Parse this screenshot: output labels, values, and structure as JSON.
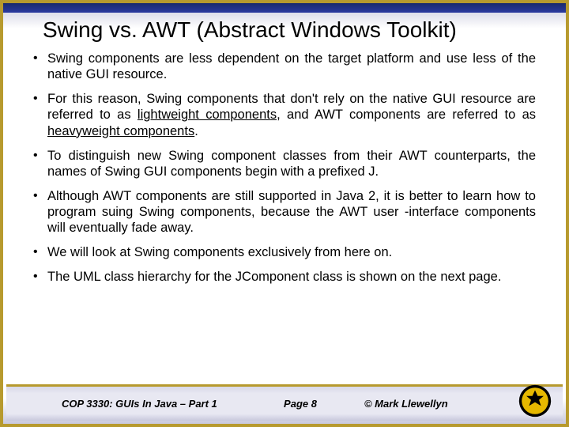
{
  "title": "Swing vs. AWT (Abstract Windows Toolkit)",
  "bullets": {
    "b0": "Swing components are less dependent on the target platform and use less of the native GUI resource.",
    "b1a": "For this reason, Swing components that don't rely on the native GUI resource are referred to as ",
    "b1u1": "lightweight components",
    "b1b": ", and AWT components are referred to as ",
    "b1u2": "heavyweight components",
    "b1c": ".",
    "b2": "To distinguish new Swing component classes from their AWT counterparts, the names of Swing GUI components begin with a prefixed J.",
    "b3": "Although AWT components are still supported in Java 2, it is better to learn how to program suing Swing components, because the AWT user -interface components will eventually fade away.",
    "b4": "We will look at Swing components exclusively from here on.",
    "b5": "The UML class hierarchy for the JComponent class is shown on the next page."
  },
  "footer": {
    "course": "COP 3330:  GUIs In Java – Part 1",
    "page": "Page 8",
    "copyright": "© Mark Llewellyn"
  }
}
